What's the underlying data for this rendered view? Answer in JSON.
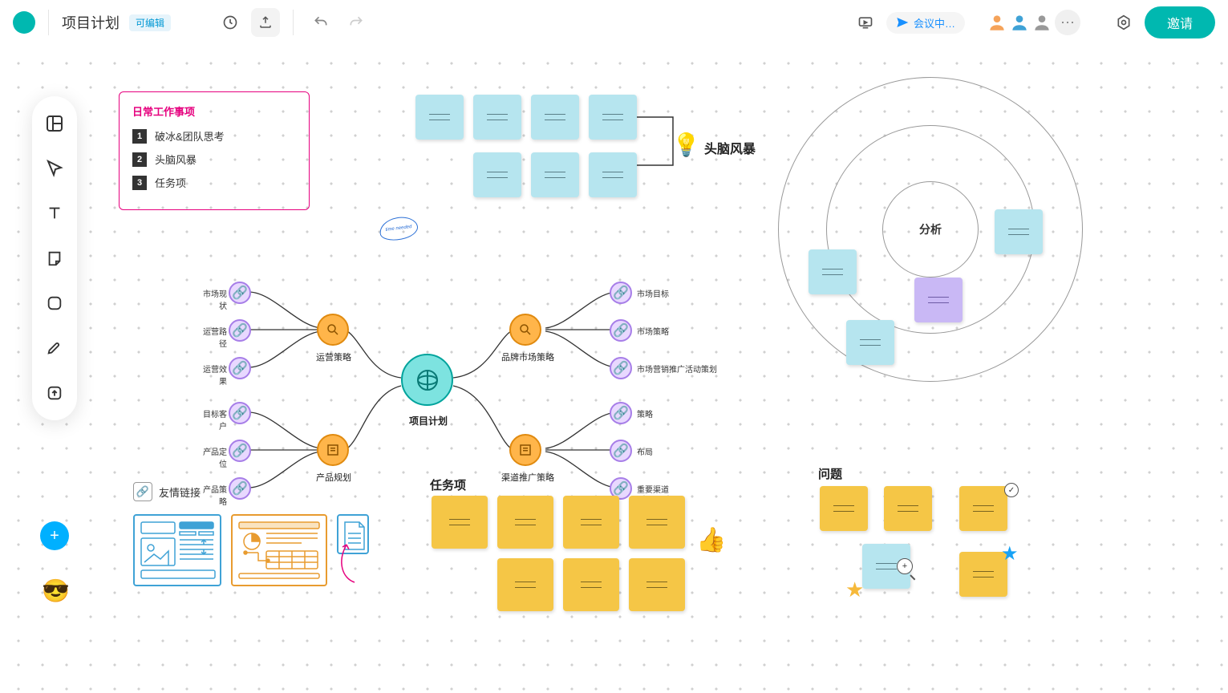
{
  "header": {
    "title": "项目计划",
    "badge": "可编辑",
    "meeting": "会议中…",
    "invite": "邀请"
  },
  "agenda": {
    "heading": "日常工作事项",
    "items": [
      "破冰&团队思考",
      "头脑风暴",
      "任务项"
    ]
  },
  "brainstorm": {
    "label": "头脑风暴",
    "annotation": "time needed"
  },
  "analysis": {
    "label": "分析"
  },
  "mindmap": {
    "center": "项目计划",
    "branches": {
      "top_left": {
        "label": "运营策略",
        "leaves": [
          "市场现状",
          "运营路径",
          "运营效果"
        ]
      },
      "bottom_left": {
        "label": "产品规划",
        "leaves": [
          "目标客户",
          "产品定位",
          "产品策略"
        ]
      },
      "top_right": {
        "label": "品牌市场策略",
        "leaves": [
          "市场目标",
          "市场策略",
          "市场营销推广活动策划"
        ]
      },
      "bottom_right": {
        "label": "渠道推广策略",
        "leaves": [
          "策略",
          "布局",
          "重要渠道"
        ]
      }
    }
  },
  "tasks": {
    "label": "任务项"
  },
  "problems": {
    "label": "问题"
  },
  "links": {
    "label": "友情链接"
  }
}
